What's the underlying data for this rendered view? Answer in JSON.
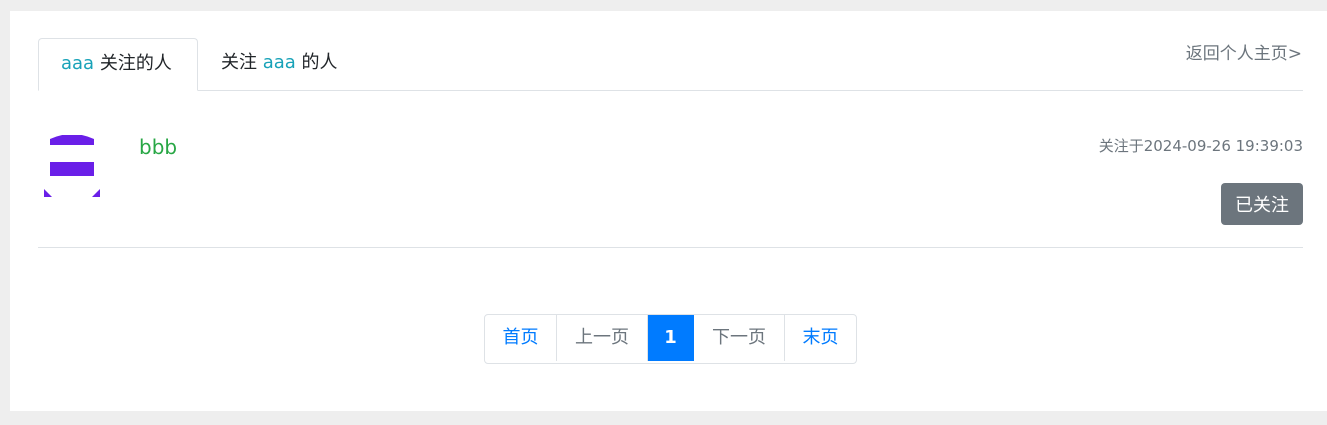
{
  "tabs": {
    "active": {
      "name": "aaa",
      "suffix": " 关注的人"
    },
    "second": {
      "prefix": "关注 ",
      "name": "aaa",
      "suffix": " 的人"
    }
  },
  "back_link": "返回个人主页>",
  "followee": {
    "username": "bbb",
    "followed_at": "关注于2024-09-26 19:39:03",
    "follow_button_label": "已关注",
    "avatar_color": "#6a1fe8"
  },
  "pagination": {
    "first": "首页",
    "prev": "上一页",
    "current": "1",
    "next": "下一页",
    "last": "末页"
  },
  "colors": {
    "accent_teal": "#17a2b8",
    "username_green": "#28a745",
    "primary_blue": "#007bff",
    "muted_gray": "#6c757d"
  }
}
